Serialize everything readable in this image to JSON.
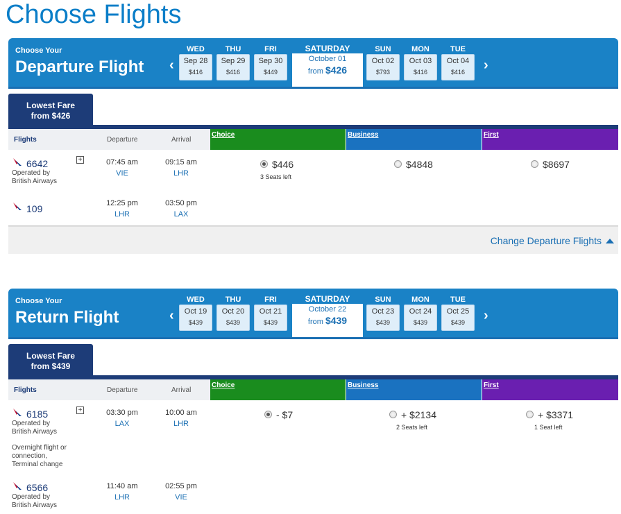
{
  "title": "Choose Flights",
  "departure": {
    "choose_your": "Choose Your",
    "kind": "Departure Flight",
    "prev_arrow": "‹",
    "next_arrow": "›",
    "days": [
      {
        "dow": "WED",
        "date": "Sep 28",
        "price": "$416"
      },
      {
        "dow": "THU",
        "date": "Sep 29",
        "price": "$416"
      },
      {
        "dow": "FRI",
        "date": "Sep 30",
        "price": "$449"
      },
      {
        "dow": "SUN",
        "date": "Oct 02",
        "price": "$793"
      },
      {
        "dow": "MON",
        "date": "Oct 03",
        "price": "$416"
      },
      {
        "dow": "TUE",
        "date": "Oct 04",
        "price": "$416"
      }
    ],
    "selected": {
      "dow": "SATURDAY",
      "date": "October 01",
      "from": "from",
      "price": "$426"
    },
    "lowest_fare": {
      "line1": "Lowest Fare",
      "line2": "from $426"
    },
    "columns": {
      "flights": "Flights",
      "departure": "Departure",
      "arrival": "Arrival",
      "choice": "Choice",
      "business": "Business",
      "first": "First"
    },
    "segments": [
      {
        "flight": "6642",
        "operated": "Operated by\nBritish Airways",
        "dep_time": "07:45 am",
        "dep_airport": "VIE",
        "arr_time": "09:15 am",
        "arr_airport": "LHR"
      },
      {
        "flight": "109",
        "operated": "",
        "dep_time": "12:25 pm",
        "dep_airport": "LHR",
        "arr_time": "03:50 pm",
        "arr_airport": "LAX"
      }
    ],
    "fares": {
      "choice": {
        "price": "$446",
        "seats": "3 Seats left",
        "selected": true
      },
      "business": {
        "price": "$4848",
        "seats": ""
      },
      "first": {
        "price": "$8697",
        "seats": ""
      }
    },
    "change_link": "Change Departure Flights"
  },
  "return": {
    "choose_your": "Choose Your",
    "kind": "Return Flight",
    "prev_arrow": "‹",
    "next_arrow": "›",
    "days": [
      {
        "dow": "WED",
        "date": "Oct 19",
        "price": "$439"
      },
      {
        "dow": "THU",
        "date": "Oct 20",
        "price": "$439"
      },
      {
        "dow": "FRI",
        "date": "Oct 21",
        "price": "$439"
      },
      {
        "dow": "SUN",
        "date": "Oct 23",
        "price": "$439"
      },
      {
        "dow": "MON",
        "date": "Oct 24",
        "price": "$439"
      },
      {
        "dow": "TUE",
        "date": "Oct 25",
        "price": "$439"
      }
    ],
    "selected": {
      "dow": "SATURDAY",
      "date": "October 22",
      "from": "from",
      "price": "$439"
    },
    "lowest_fare": {
      "line1": "Lowest Fare",
      "line2": "from $439"
    },
    "columns": {
      "flights": "Flights",
      "departure": "Departure",
      "arrival": "Arrival",
      "choice": "Choice",
      "business": "Business",
      "first": "First"
    },
    "segments": [
      {
        "flight": "6185",
        "operated": "Operated by\nBritish Airways",
        "note": "Overnight flight or\nconnection,\nTerminal change",
        "dep_time": "03:30 pm",
        "dep_airport": "LAX",
        "arr_time": "10:00 am",
        "arr_airport": "LHR"
      },
      {
        "flight": "6566",
        "operated": "Operated by\nBritish Airways",
        "dep_time": "11:40 am",
        "dep_airport": "LHR",
        "arr_time": "02:55 pm",
        "arr_airport": "VIE"
      }
    ],
    "fares": {
      "choice": {
        "price": "- $7",
        "seats": "",
        "selected": true
      },
      "business": {
        "price": "+ $2134",
        "seats": "2 Seats left"
      },
      "first": {
        "price": "+ $3371",
        "seats": "1 Seat left"
      }
    }
  },
  "colors": {
    "brand_blue": "#1a82c6",
    "navy": "#1d3c78",
    "choice_green": "#1a8c1e",
    "business_blue": "#1a72c0",
    "first_purple": "#6a1fb0"
  }
}
